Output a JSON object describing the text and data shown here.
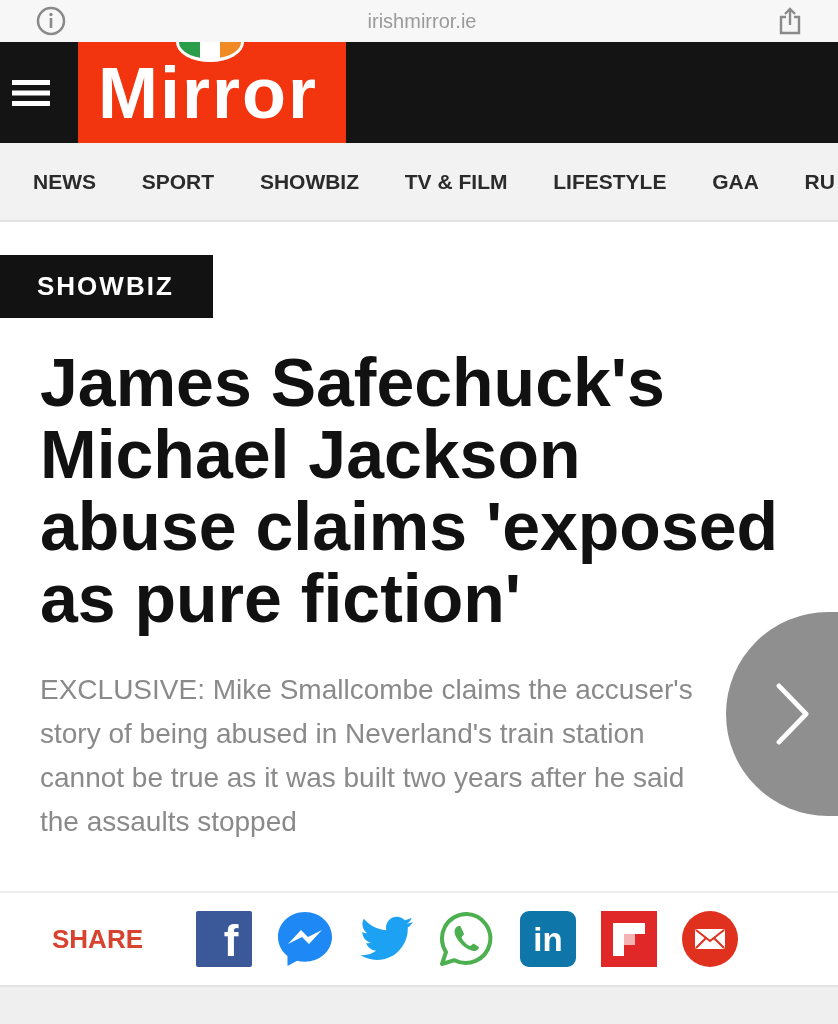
{
  "browser_bar": {
    "url": "irishmirror.ie"
  },
  "header": {
    "logo": "Mirror"
  },
  "nav": {
    "items": [
      "NEWS",
      "SPORT",
      "SHOWBIZ",
      "TV & FILM",
      "LIFESTYLE",
      "GAA",
      "RU"
    ]
  },
  "article": {
    "section_tag": "SHOWBIZ",
    "headline": "James Safechuck's Michael Jackson abuse claims 'exposed as pure fiction'",
    "standfirst": "EXCLUSIVE: Mike Smallcombe claims the accuser's story of being abused in Neverland's train station cannot be true as it was built two years after he said the assaults stopped"
  },
  "share": {
    "label": "SHARE",
    "buttons": [
      {
        "kind": "facebook",
        "glyph": "f"
      },
      {
        "kind": "messenger"
      },
      {
        "kind": "twitter"
      },
      {
        "kind": "whatsapp"
      },
      {
        "kind": "linkedin",
        "glyph": "in"
      },
      {
        "kind": "flipboard"
      },
      {
        "kind": "email"
      }
    ]
  }
}
